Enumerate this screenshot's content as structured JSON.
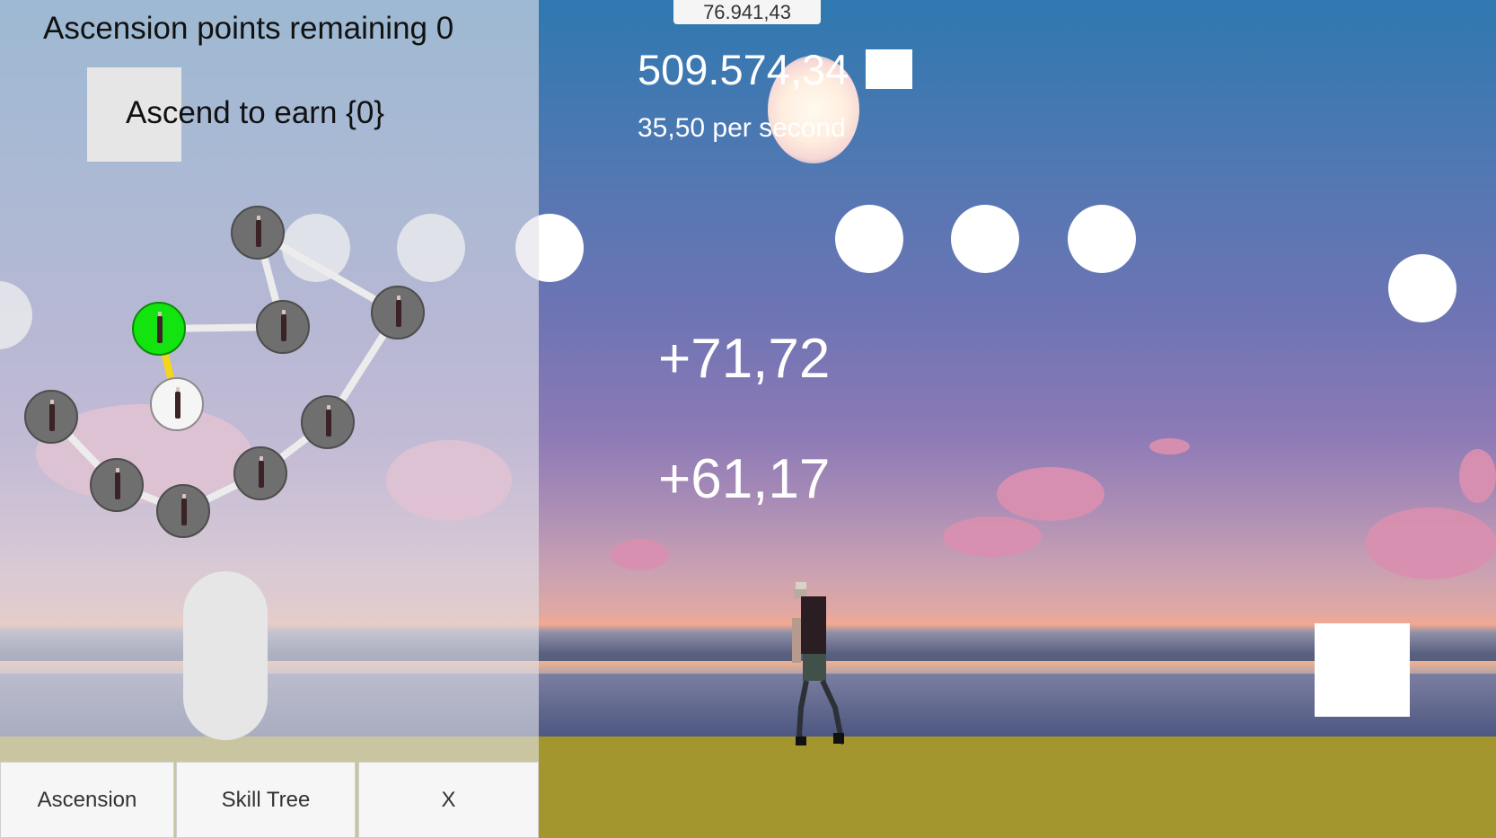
{
  "hud": {
    "top_value": "76.941,43",
    "currency_total": "509.574,34",
    "per_second": "35,50 per second",
    "popups": [
      "+71,72",
      "+61,17"
    ]
  },
  "ascension": {
    "points_label": "Ascension points remaining 0",
    "ascend_button_label": "Ascend to earn {0}"
  },
  "tabs": [
    {
      "label": "Ascension"
    },
    {
      "label": "Skill Tree"
    },
    {
      "label": "X"
    }
  ],
  "colors": {
    "selected_node": "#13e30f",
    "active_link": "#f5d51a",
    "node_default": "#6f6f6f"
  },
  "skill_tree": {
    "nodes": [
      {
        "id": "n1",
        "state": "locked",
        "icon": "zombie-figure-icon"
      },
      {
        "id": "n2",
        "state": "selected",
        "icon": "zombie-figure-icon"
      },
      {
        "id": "n3",
        "state": "locked",
        "icon": "zombie-figure-icon"
      },
      {
        "id": "n4",
        "state": "locked",
        "icon": "zombie-figure-icon"
      },
      {
        "id": "n5",
        "state": "available",
        "icon": "zombie-figure-icon"
      },
      {
        "id": "n6",
        "state": "locked",
        "icon": "zombie-figure-icon"
      },
      {
        "id": "n7",
        "state": "locked",
        "icon": "zombie-figure-icon"
      },
      {
        "id": "n8",
        "state": "locked",
        "icon": "zombie-figure-icon"
      },
      {
        "id": "n9",
        "state": "locked",
        "icon": "zombie-figure-icon"
      },
      {
        "id": "n10",
        "state": "locked",
        "icon": "zombie-figure-icon"
      },
      {
        "id": "n11",
        "state": "locked",
        "icon": "zombie-figure-icon"
      }
    ]
  }
}
